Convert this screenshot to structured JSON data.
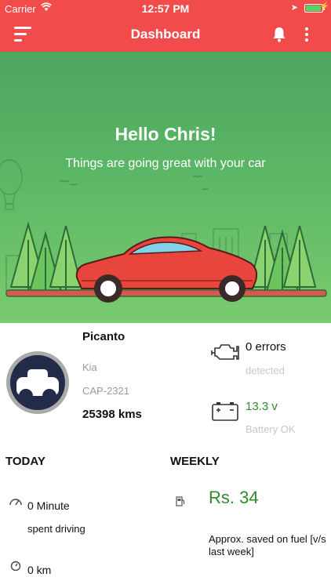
{
  "status_bar": {
    "carrier": "Carrier",
    "time": "12:57 PM"
  },
  "nav": {
    "title": "Dashboard",
    "menu_icon": "hamburger-menu-icon",
    "bell_icon": "bell-icon",
    "more_icon": "more-vertical-icon"
  },
  "hero": {
    "greeting": "Hello Chris!",
    "message": "Things are going great with your car"
  },
  "car": {
    "name": "Picanto",
    "make": "Kia",
    "plate": "CAP-2321",
    "odometer": "25398 kms"
  },
  "diagnostics": {
    "errors_value": "0 errors",
    "errors_label": "detected",
    "battery_value": "13.3 v",
    "battery_label": "Battery OK"
  },
  "today": {
    "heading": "TODAY",
    "driving_value": "0 Minute",
    "driving_label": "spent driving",
    "distance_value": "0 km"
  },
  "weekly": {
    "heading": "WEEKLY",
    "saved_value": "Rs. 34",
    "saved_label": "Approx. saved on fuel [v/s last week]"
  },
  "colors": {
    "brand_red": "#f24b4b",
    "hero_green": "#5bb765",
    "value_green": "#2e8b2e",
    "muted_text": "#9a9a9a"
  }
}
